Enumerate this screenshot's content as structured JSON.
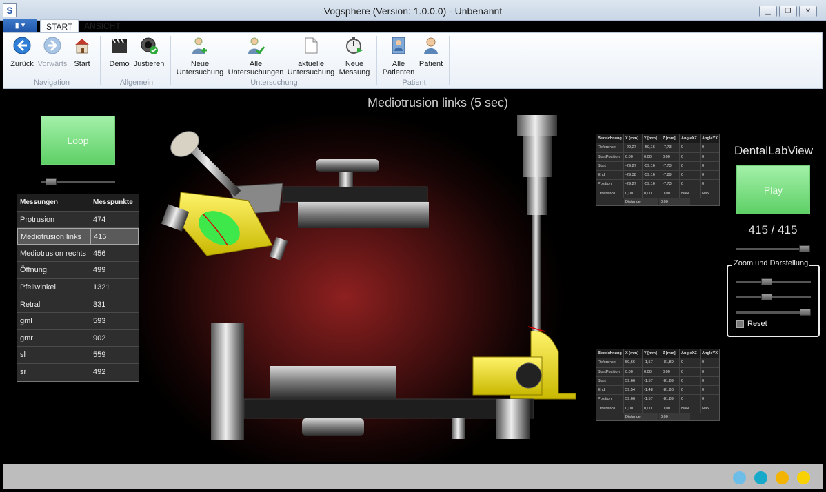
{
  "window": {
    "title": "Vogsphere (Version: 1.0.0.0) - Unbenannt",
    "logo": "S"
  },
  "ribbon": {
    "tabs": [
      {
        "label": "START"
      },
      {
        "label": "ANSICHT"
      }
    ],
    "buttons": [
      {
        "label": "Zurück"
      },
      {
        "label": "Vorwärts"
      },
      {
        "label": "Start"
      },
      {
        "label": "Demo"
      },
      {
        "label": "Justieren"
      },
      {
        "label1": "Neue",
        "label2": "Untersuchung"
      },
      {
        "label1": "Alle",
        "label2": "Untersuchungen"
      },
      {
        "label1": "aktuelle",
        "label2": "Untersuchung"
      },
      {
        "label1": "Neue",
        "label2": "Messung"
      },
      {
        "label1": "Alle",
        "label2": "Patienten"
      },
      {
        "label": "Patient"
      }
    ],
    "groups": [
      {
        "label": "Navigation"
      },
      {
        "label": "Allgemein"
      },
      {
        "label": "Untersuchung"
      },
      {
        "label": "Patient"
      }
    ]
  },
  "main": {
    "measurement_title": "Mediotrusion links (5 sec)",
    "loop_label": "Loop",
    "table": {
      "headers": [
        "Messungen",
        "Messpunkte"
      ],
      "rows": [
        [
          "Protrusion",
          "474"
        ],
        [
          "Mediotrusion links",
          "415"
        ],
        [
          "Mediotrusion rechts",
          "456"
        ],
        [
          "Öffnung",
          "499"
        ],
        [
          "Pfeilwinkel",
          "1321"
        ],
        [
          "Retral",
          "331"
        ],
        [
          "gml",
          "593"
        ],
        [
          "gmr",
          "902"
        ],
        [
          "sl",
          "559"
        ],
        [
          "sr",
          "492"
        ]
      ],
      "selected_index": 1
    }
  },
  "grids": [
    {
      "headers": [
        "Bezeichnung",
        "X [mm]",
        "Y [mm]",
        "Z [mm]",
        "AngleXZ",
        "AngleYX"
      ],
      "rows": [
        [
          "Reference",
          "-29,27",
          "-59,16",
          "-7,73",
          "0",
          "0"
        ],
        [
          "StartPosition",
          "0,00",
          "0,00",
          "0,00",
          "0",
          "0"
        ],
        [
          "Start",
          "-29,27",
          "-59,16",
          "-7,73",
          "0",
          "0"
        ],
        [
          "End",
          "-29,38",
          "-59,16",
          "-7,89",
          "0",
          "0"
        ],
        [
          "Position",
          "-29,27",
          "-59,16",
          "-7,73",
          "0",
          "0"
        ],
        [
          "Difference",
          "0,00",
          "0,00",
          "0,00",
          "NaN",
          "NaN"
        ]
      ],
      "distance_label": "Distance:",
      "distance_value": "0,00"
    },
    {
      "headers": [
        "Bezeichnung",
        "X [mm]",
        "Y [mm]",
        "Z [mm]",
        "AngleXZ",
        "AngleYX"
      ],
      "rows": [
        [
          "Reference",
          "59,66",
          "-1,57",
          "-81,89",
          "0",
          "0"
        ],
        [
          "StartPosition",
          "0,00",
          "0,00",
          "0,00",
          "0",
          "0"
        ],
        [
          "Start",
          "59,66",
          "-1,57",
          "-81,89",
          "0",
          "0"
        ],
        [
          "End",
          "59,54",
          "-1,48",
          "-81,98",
          "0",
          "0"
        ],
        [
          "Position",
          "59,66",
          "-1,57",
          "-81,89",
          "0",
          "0"
        ],
        [
          "Difference",
          "0,00",
          "0,00",
          "0,00",
          "NaN",
          "NaN"
        ]
      ],
      "distance_label": "Distance:",
      "distance_value": "0,00"
    }
  ],
  "right_panel": {
    "title": "DentalLabView",
    "play_label": "Play",
    "counter": "415 / 415",
    "zoom_legend": "Zoom und Darstellung",
    "reset_label": "Reset",
    "progress_fraction": 1.0
  },
  "status": {
    "dot_colors": [
      "#6cbde8",
      "#17a9c9",
      "#f2b400",
      "#f7d200"
    ]
  },
  "colors": {
    "accent_green": "#6fd876",
    "ribbon_blue": "#2a64b8",
    "articulator_yellow": "#f0e000"
  }
}
